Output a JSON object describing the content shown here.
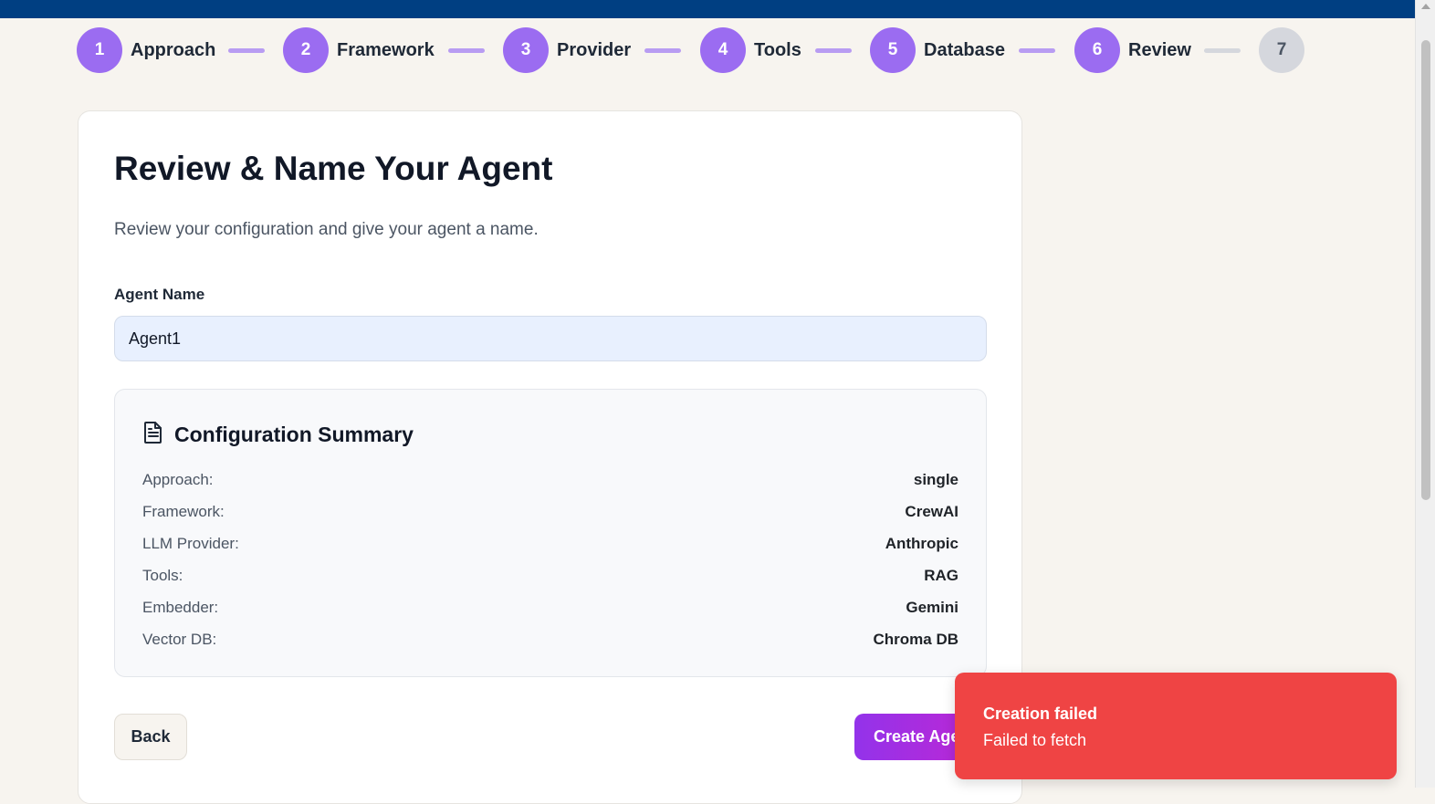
{
  "colors": {
    "topbar": "#003f82",
    "step_active": "#9b6cf1",
    "step_inactive": "#d5d7dd",
    "toast": "#ef4444"
  },
  "steps": [
    {
      "number": "1",
      "label": "Approach",
      "state": "complete"
    },
    {
      "number": "2",
      "label": "Framework",
      "state": "complete"
    },
    {
      "number": "3",
      "label": "Provider",
      "state": "complete"
    },
    {
      "number": "4",
      "label": "Tools",
      "state": "complete"
    },
    {
      "number": "5",
      "label": "Database",
      "state": "complete"
    },
    {
      "number": "6",
      "label": "Review",
      "state": "current"
    },
    {
      "number": "7",
      "label": "",
      "state": "upcoming"
    }
  ],
  "page": {
    "title": "Review & Name Your Agent",
    "subtitle": "Review your configuration and give your agent a name."
  },
  "agent_name": {
    "label": "Agent Name",
    "value": "Agent1"
  },
  "summary": {
    "icon": "document-icon",
    "title": "Configuration Summary",
    "rows": [
      {
        "key": "Approach:",
        "value": "single"
      },
      {
        "key": "Framework:",
        "value": "CrewAI"
      },
      {
        "key": "LLM Provider:",
        "value": "Anthropic"
      },
      {
        "key": "Tools:",
        "value": "RAG"
      },
      {
        "key": "Embedder:",
        "value": "Gemini"
      },
      {
        "key": "Vector DB:",
        "value": "Chroma DB"
      }
    ]
  },
  "buttons": {
    "back": "Back",
    "create": "Create Agent"
  },
  "toast": {
    "title": "Creation failed",
    "message": "Failed to fetch"
  }
}
